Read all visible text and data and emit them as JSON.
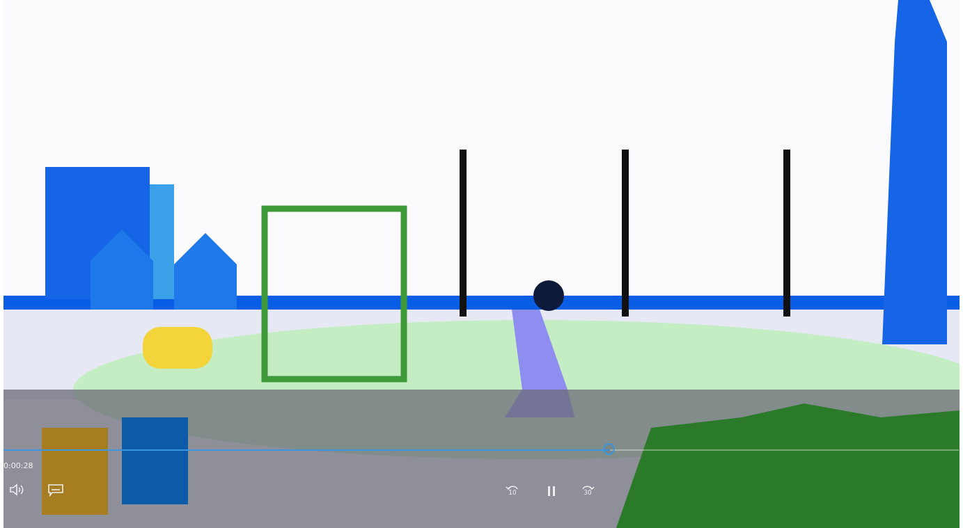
{
  "player": {
    "progress": {
      "level": 0.635
    },
    "elapsed": "0:00:28",
    "skip_back": "10",
    "skip_forward": "30",
    "playing": true
  }
}
